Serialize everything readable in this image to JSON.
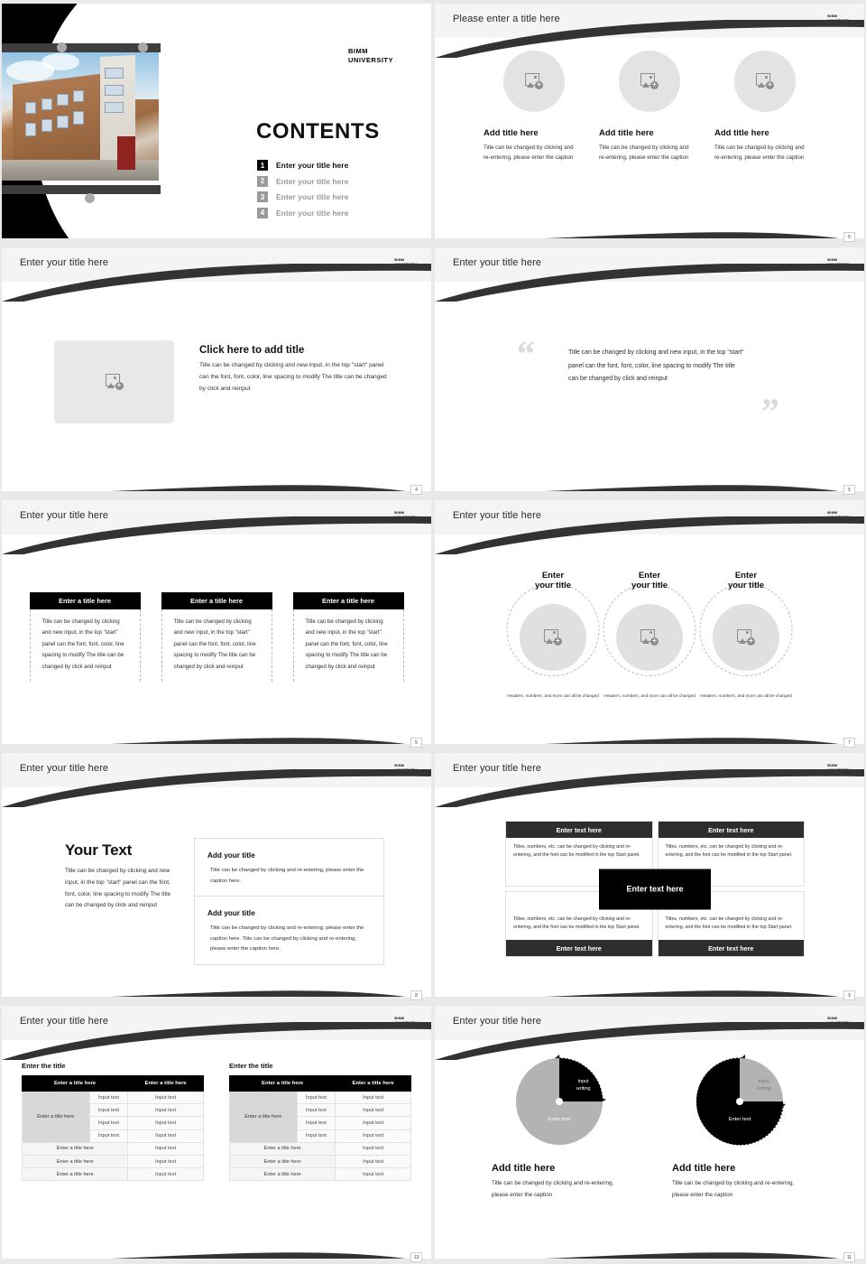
{
  "brand": {
    "logo_line1": "BIMM",
    "logo_line2": "UNIVERSITY"
  },
  "slides": [
    {
      "num": "",
      "kind": "cover",
      "title": "CONTENTS",
      "toc": [
        {
          "num": "1",
          "label": "Enter your title here"
        },
        {
          "num": "2",
          "label": "Enter your title here"
        },
        {
          "num": "3",
          "label": "Enter your title here"
        },
        {
          "num": "4",
          "label": "Enter your title here"
        }
      ]
    },
    {
      "num": "5",
      "kind": "three-circles",
      "header": "Please enter a title here",
      "cards": [
        {
          "title": "Add title here",
          "body": "Title can be changed by clicking and re-entering, please enter the caption"
        },
        {
          "title": "Add title here",
          "body": "Title can be changed by clicking and re-entering, please enter the caption"
        },
        {
          "title": "Add title here",
          "body": "Title can be changed by clicking and re-entering, please enter the caption"
        }
      ]
    },
    {
      "num": "4",
      "kind": "image-text",
      "header": "Enter your title here",
      "title": "Click here to add title",
      "body": "Title can be changed by clicking and new input, in the top \"start\" panel can the font, font, color, line spacing to modify The title can be changed by click and reinput"
    },
    {
      "num": "5",
      "kind": "quote",
      "header": "Enter your title here",
      "quote_open": "“",
      "quote_close": "”",
      "body": "Title can be changed by clicking and new input, in the top \"start\" panel can the font, font, color, line spacing to modify The title can be changed by click and reinput"
    },
    {
      "num": "5",
      "kind": "three-cards",
      "header": "Enter your title here",
      "cards": [
        {
          "title": "Enter a title here",
          "body": "Title can be changed by clicking and new input, in the top \"start\" panel can the font, font, color, line spacing to modify The title can be changed by click and reinput"
        },
        {
          "title": "Enter a title here",
          "body": "Title can be changed by clicking and new input, in the top \"start\" panel can the font, font, color, line spacing to modify The title can be changed by click and reinput"
        },
        {
          "title": "Enter a title here",
          "body": "Title can be changed by clicking and new input, in the top \"start\" panel can the font, font, color, line spacing to modify The title can be changed by click and reinput"
        }
      ]
    },
    {
      "num": "7",
      "kind": "dashed-circles",
      "header": "Enter your title here",
      "cards": [
        {
          "title_line1": "Enter",
          "title_line2": "your title",
          "caption": "Headers, numbers, and more can all be changed"
        },
        {
          "title_line1": "Enter",
          "title_line2": "your title",
          "caption": "Headers, numbers, and more can all be changed"
        },
        {
          "title_line1": "Enter",
          "title_line2": "your title",
          "caption": "Headers, numbers, and more can all be changed"
        }
      ]
    },
    {
      "num": "8",
      "kind": "your-text",
      "header": "Enter your title here",
      "big_title": "Your Text",
      "big_body": "Title can be changed by clicking and new input, in the top \"start\" panel can the font, font, color, line spacing to modify The title can be changed by click and reinput",
      "boxes": [
        {
          "title": "Add your title",
          "body": "Title can be changed by clicking and re-entering, please enter the caption here."
        },
        {
          "title": "Add your title",
          "body": "Title can be changed by clicking and re-entering, please enter the caption here. Title can be changed by clicking and re-entering, please enter the caption here."
        }
      ]
    },
    {
      "num": "9",
      "kind": "quad",
      "header": "Enter your title here",
      "center_label": "Enter text here",
      "cells": [
        {
          "bar": "Enter text here",
          "bar_pos": "top",
          "body": "Titles, numbers, etc. can be changed by clicking and re-entering, and the font can be modified in the top Start panel."
        },
        {
          "bar": "Enter text here",
          "bar_pos": "top",
          "body": "Titles, numbers, etc. can be changed by clicking and re-entering, and the font can be modified in the top Start panel."
        },
        {
          "bar": "Enter text here",
          "bar_pos": "bottom",
          "body": "Titles, numbers, etc. can be changed by clicking and re-entering, and the font can be modified in the top Start panel."
        },
        {
          "bar": "Enter text here",
          "bar_pos": "bottom",
          "body": "Titles, numbers, etc. can be changed by clicking and re-entering, and the font can be modified in the top Start panel."
        }
      ]
    },
    {
      "num": "13",
      "kind": "tables",
      "header": "Enter your title here",
      "tables": [
        {
          "caption": "Enter the title",
          "headers": [
            "Enter a title here",
            "Enter a title here"
          ],
          "rowhead": "Enter a title here",
          "grouped_rows": [
            [
              "Input text",
              "Input text"
            ],
            [
              "Input text",
              "Input text"
            ],
            [
              "Input text",
              "Input text"
            ],
            [
              "Input text",
              "Input text"
            ]
          ],
          "plain_rows": [
            [
              "Enter a title here",
              "Input text"
            ],
            [
              "Enter a title here",
              "Input text"
            ],
            [
              "Enter a title here",
              "Input text"
            ]
          ]
        },
        {
          "caption": "Enter the title",
          "headers": [
            "Enter a title here",
            "Enter a title here"
          ],
          "rowhead": "Enter a title here",
          "grouped_rows": [
            [
              "Input text",
              "Input text"
            ],
            [
              "Input text",
              "Input text"
            ],
            [
              "Input text",
              "Input text"
            ],
            [
              "Input text",
              "Input text"
            ]
          ],
          "plain_rows": [
            [
              "Enter a title here",
              "Input text"
            ],
            [
              "Enter a title here",
              "Input text"
            ],
            [
              "Enter a title here",
              "Input text"
            ]
          ]
        }
      ]
    },
    {
      "num": "11",
      "kind": "pies",
      "header": "Enter your title here",
      "pies": [
        {
          "slice_label_l1": "input",
          "slice_label_l2": "writing",
          "main_label": "Enter text",
          "title": "Add title here",
          "body": "Title can be changed by clicking and re-entering, please enter the caption"
        },
        {
          "slice_label_l1": "input",
          "slice_label_l2": "writing",
          "main_label": "Enter text",
          "title": "Add title here",
          "body": "Title can be changed by clicking and re-entering, please enter the caption"
        }
      ]
    }
  ],
  "chart_data": [
    {
      "type": "pie",
      "title": "Add title here",
      "labels": [
        "input writing",
        "Enter text"
      ],
      "values": [
        25,
        75
      ],
      "colors": [
        "#000000",
        "#b3b3b3"
      ],
      "start_angle_deg": 0,
      "legend": "none"
    },
    {
      "type": "pie",
      "title": "Add title here",
      "labels": [
        "input writing",
        "Enter text"
      ],
      "values": [
        25,
        75
      ],
      "colors": [
        "#b3b3b3",
        "#000000"
      ],
      "start_angle_deg": 0,
      "legend": "none"
    }
  ]
}
